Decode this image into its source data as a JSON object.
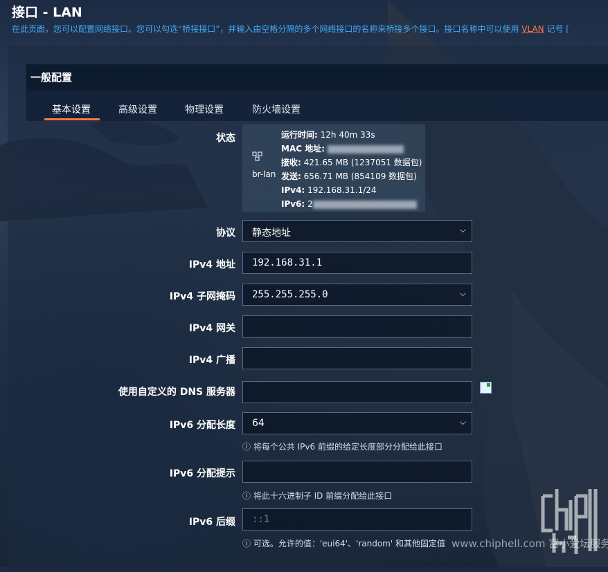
{
  "page": {
    "title": "接口 - LAN",
    "description_prefix": "在此页面，您可以配置网络接口。您可以勾选“桥接接口”，并输入由空格分隔的多个网络接口的名称来桥接多个接口。接口名称中可以使用 ",
    "description_link": "VLAN",
    "description_suffix": " 记号 ["
  },
  "section": {
    "title": "一般配置"
  },
  "tabs": [
    {
      "label": "基本设置",
      "active": true
    },
    {
      "label": "高级设置",
      "active": false
    },
    {
      "label": "物理设置",
      "active": false
    },
    {
      "label": "防火墙设置",
      "active": false
    }
  ],
  "status": {
    "label": "状态",
    "interface_icon": "network-interface-icon",
    "interface_name": "br-lan",
    "uptime_key": "运行时间:",
    "uptime_value": "12h 40m 33s",
    "mac_key": "MAC 地址:",
    "rx_key": "接收:",
    "rx_value": "421.65 MB (1237051 数据包)",
    "tx_key": "发送:",
    "tx_value": "656.71 MB (854109 数据包)",
    "ipv4_key": "IPv4:",
    "ipv4_value": "192.168.31.1/24",
    "ipv6_key": "IPv6:",
    "ipv6_value_visible": "2"
  },
  "fields": {
    "protocol": {
      "label": "协议",
      "value": "静态地址"
    },
    "ipv4_addr": {
      "label": "IPv4 地址",
      "value": "192.168.31.1"
    },
    "ipv4_mask": {
      "label": "IPv4 子网掩码",
      "value": "255.255.255.0"
    },
    "ipv4_gw": {
      "label": "IPv4 网关",
      "value": ""
    },
    "ipv4_bcast": {
      "label": "IPv4 广播",
      "value": ""
    },
    "dns": {
      "label": "使用自定义的 DNS 服务器",
      "value": ""
    },
    "ipv6_assign": {
      "label": "IPv6 分配长度",
      "value": "64",
      "hint": "将每个公共 IPv6 前缀的给定长度部分分配给此接口"
    },
    "ipv6_hint": {
      "label": "IPv6 分配提示",
      "value": "",
      "hint": "将此十六进制子 ID 前缀分配给此接口"
    },
    "ipv6_suffix": {
      "label": "IPv6 后缀",
      "placeholder": "::1",
      "hint": "可选。允许的值：'eui64'、'random' 和其他固定值"
    }
  },
  "watermark": "www.chiphell.com  富小爱坛服务器",
  "logo": "chiphell-logo"
}
